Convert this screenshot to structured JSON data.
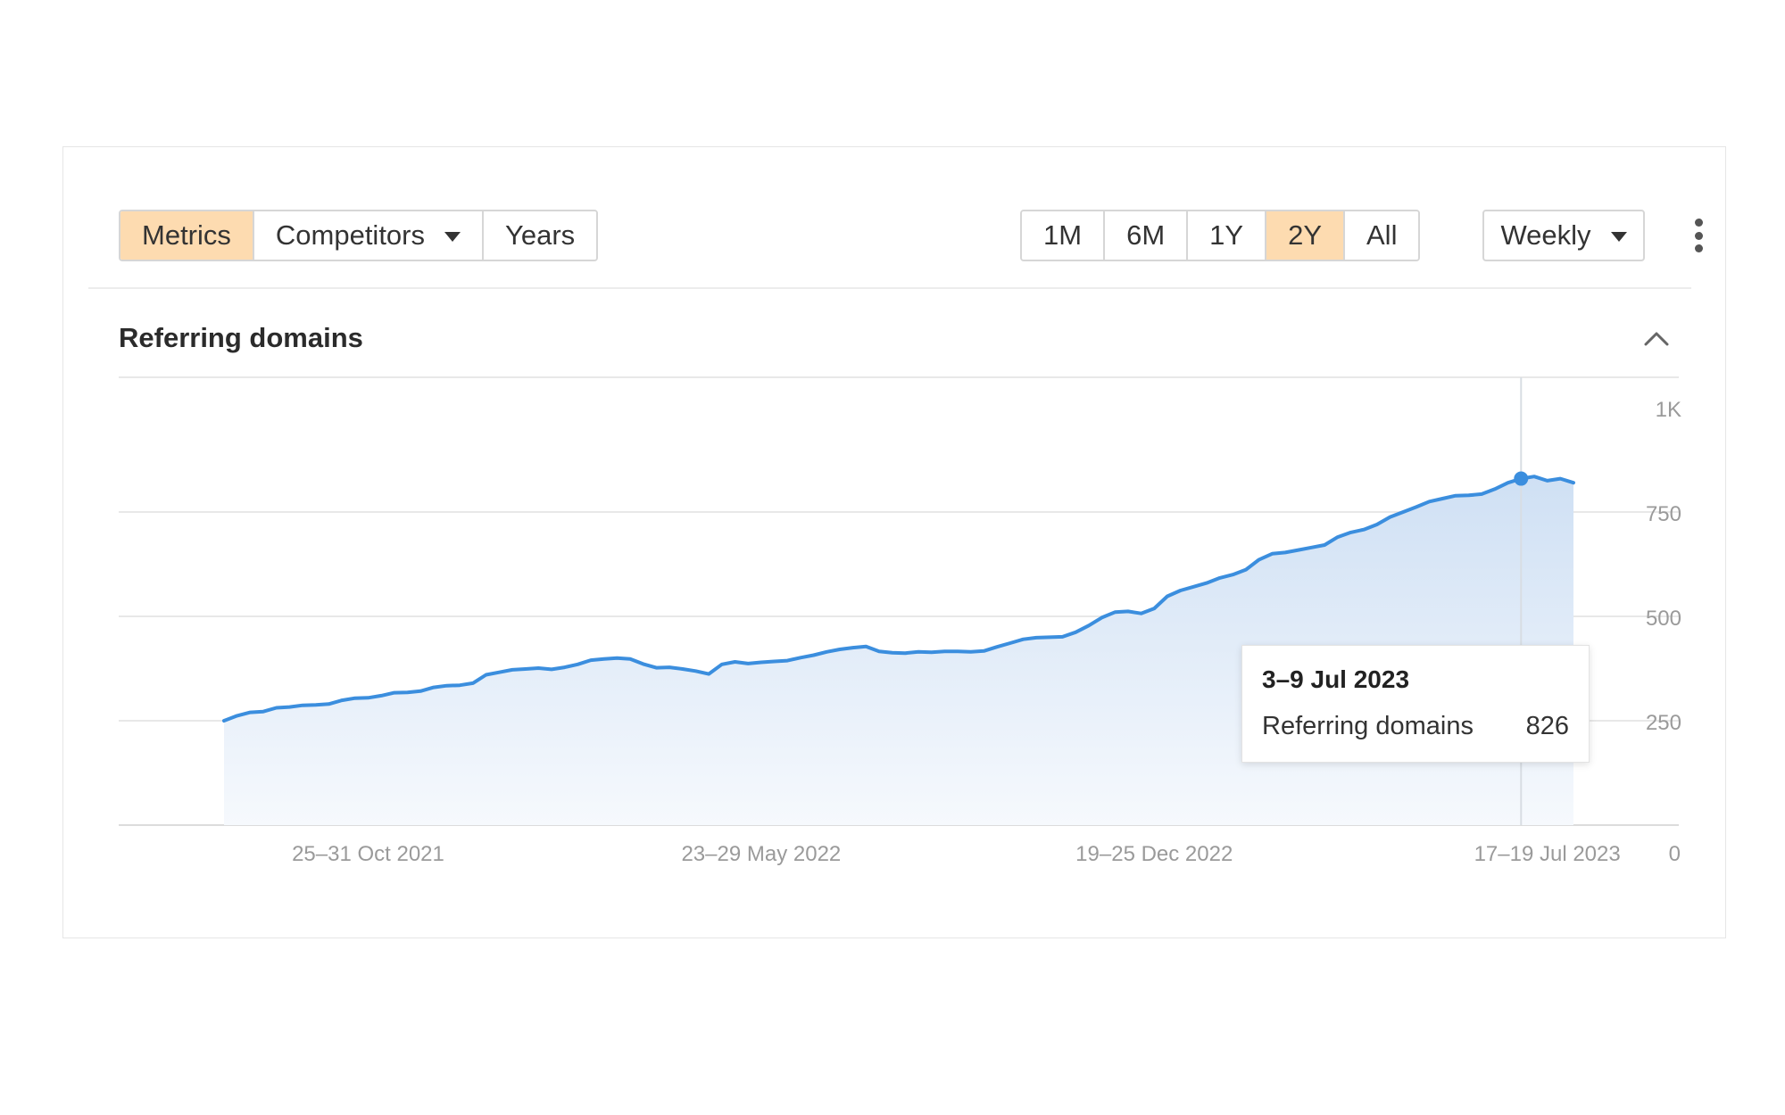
{
  "toolbar": {
    "metrics_label": "Metrics",
    "competitors_label": "Competitors",
    "years_label": "Years",
    "ranges": [
      "1M",
      "6M",
      "1Y",
      "2Y",
      "All"
    ],
    "active_range": "2Y",
    "interval_label": "Weekly"
  },
  "colors": {
    "accent": "#fddbb0",
    "line": "#3b8ede",
    "area_top": "#cfe0f4",
    "area_bottom": "#f6f9fd"
  },
  "section": {
    "title": "Referring domains"
  },
  "tooltip": {
    "date": "3–9 Jul 2023",
    "metric_label": "Referring domains",
    "metric_value": "826"
  },
  "chart_data": {
    "type": "area",
    "title": "Referring domains",
    "ylim": [
      0,
      1000
    ],
    "y_ticks": [
      {
        "value": 0,
        "label": "0"
      },
      {
        "value": 250,
        "label": "250"
      },
      {
        "value": 500,
        "label": "500"
      },
      {
        "value": 750,
        "label": "750"
      },
      {
        "value": 1000,
        "label": "1K"
      }
    ],
    "x_ticks": [
      {
        "index": 11,
        "label": "25–31 Oct 2021"
      },
      {
        "index": 41,
        "label": "23–29 May 2022"
      },
      {
        "index": 71,
        "label": "19–25 Dec 2022"
      },
      {
        "index": 101,
        "label": "17–19 Jul 2023"
      }
    ],
    "highlight_index": 99,
    "grid": true,
    "series": [
      {
        "values": [
          250,
          262,
          270,
          272,
          281,
          283,
          287,
          288,
          290,
          299,
          304,
          305,
          310,
          317,
          318,
          321,
          330,
          334,
          335,
          340,
          360,
          366,
          372,
          374,
          376,
          373,
          378,
          385,
          395,
          398,
          400,
          398,
          386,
          377,
          378,
          374,
          369,
          362,
          385,
          391,
          387,
          390,
          392,
          394,
          401,
          407,
          415,
          421,
          425,
          428,
          416,
          413,
          412,
          415,
          414,
          416,
          416,
          415,
          417,
          427,
          436,
          445,
          449,
          450,
          451,
          462,
          478,
          497,
          510,
          512,
          507,
          519,
          548,
          562,
          571,
          580,
          592,
          600,
          612,
          636,
          650,
          653,
          659,
          665,
          671,
          690,
          701,
          708,
          720,
          738,
          750,
          762,
          775,
          782,
          789,
          790,
          793,
          805,
          820,
          830,
          835,
          825,
          830,
          820
        ]
      }
    ]
  }
}
